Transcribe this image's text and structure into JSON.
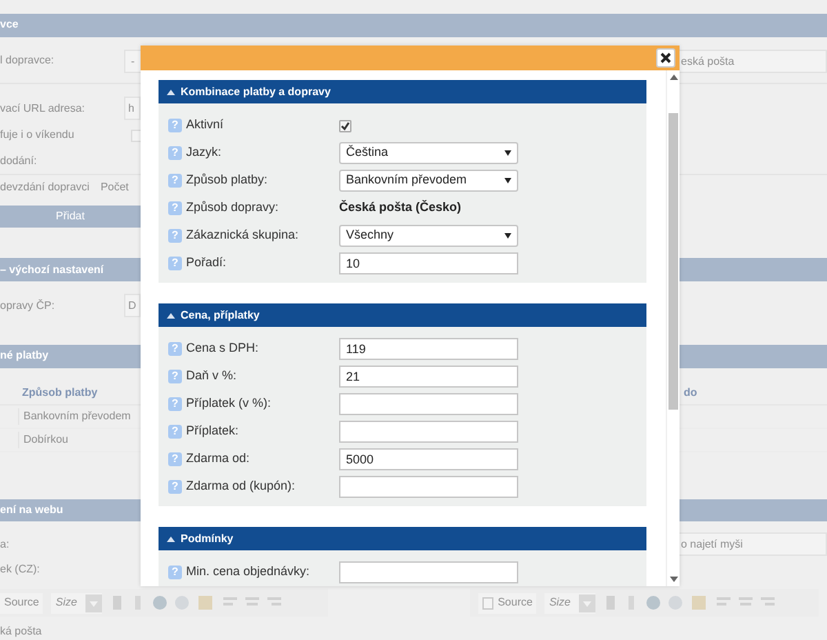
{
  "background": {
    "header": "vce",
    "carrier_label": "l dopravce:",
    "carrier_select": "-",
    "carrier_value": "eská pošta",
    "url_label": "vací URL adresa:",
    "url_value": "h",
    "weekend_label": "fuje i o víkendu",
    "weekend_checked": false,
    "delivery_label": "dodání:",
    "columns": [
      "devzdání dopravci",
      "Počet"
    ],
    "add_button": "Přidat",
    "defaults_header": "– výchozí nastavení",
    "cp_label": "opravy ČP:",
    "cp_value": "D",
    "payments_header": "né platby",
    "payments_column": "Způsob platby",
    "payments_column_right": "do",
    "payments_rows": [
      "Bankovním převodem",
      "Dobírkou"
    ],
    "web_header": "ení na webu",
    "web_labels": [
      "a:",
      "ek (CZ):"
    ],
    "hover_value": "o najetí myši",
    "editors": [
      {
        "source": "Source",
        "size": "Size"
      },
      {
        "source": "Source",
        "size": "Size"
      }
    ],
    "editor_text": "ká pošta"
  },
  "modal": {
    "sections": [
      {
        "title": "Kombinace platby a dopravy",
        "expanded": true,
        "rows": [
          {
            "kind": "checkbox",
            "help": "?",
            "label": "Aktivní",
            "checked": true
          },
          {
            "kind": "select",
            "help": "?",
            "label": "Jazyk:",
            "value": "Čeština"
          },
          {
            "kind": "select",
            "help": "?",
            "label": "Způsob platby:",
            "value": "Bankovním převodem"
          },
          {
            "kind": "static",
            "help": "?",
            "label": "Způsob dopravy:",
            "value": "Česká pošta (Česko)"
          },
          {
            "kind": "select",
            "help": "?",
            "label": "Zákaznická skupina:",
            "value": "Všechny"
          },
          {
            "kind": "input",
            "help": "?",
            "label": "Pořadí:",
            "value": "10"
          }
        ]
      },
      {
        "title": "Cena, příplatky",
        "expanded": true,
        "rows": [
          {
            "kind": "input",
            "help": "?",
            "label": "Cena s DPH:",
            "value": "119"
          },
          {
            "kind": "input",
            "help": "?",
            "label": "Daň v %:",
            "value": "21"
          },
          {
            "kind": "input",
            "help": "?",
            "label": "Příplatek (v %):"
          },
          {
            "kind": "input",
            "help": "?",
            "label": "Příplatek:"
          },
          {
            "kind": "input",
            "help": "?",
            "label": "Zdarma od:",
            "value": "5000"
          },
          {
            "kind": "input",
            "help": "?",
            "label": "Zdarma od (kupón):"
          }
        ]
      },
      {
        "title": "Podmínky",
        "expanded": true,
        "rows": [
          {
            "kind": "input",
            "help": "?",
            "label": "Min. cena objednávky:"
          }
        ]
      }
    ]
  }
}
